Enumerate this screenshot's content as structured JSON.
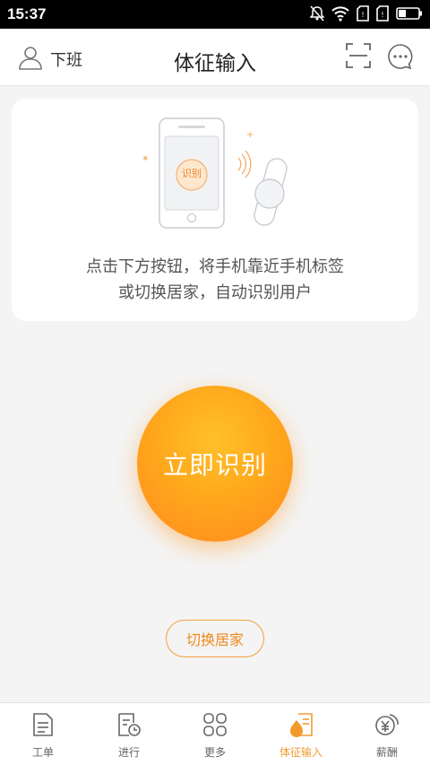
{
  "status_bar": {
    "time": "15:37"
  },
  "header": {
    "user_label": "下班",
    "title": "体征输入"
  },
  "card": {
    "chip_label": "识别",
    "instruction_line1": "点击下方按钮，将手机靠近手机标签",
    "instruction_line2": "或切换居家，自动识别用户"
  },
  "main": {
    "identify_button": "立即识别",
    "switch_home_button": "切换居家"
  },
  "tabs": [
    {
      "label": "工单",
      "icon": "document-icon"
    },
    {
      "label": "进行",
      "icon": "clock-document-icon"
    },
    {
      "label": "更多",
      "icon": "grid-icon"
    },
    {
      "label": "体征输入",
      "icon": "vital-signs-icon",
      "active": true
    },
    {
      "label": "薪酬",
      "icon": "yuan-coin-icon"
    }
  ],
  "colors": {
    "accent": "#f39a2d",
    "button_top": "#ffc02b",
    "button_bottom": "#ff8a1e"
  }
}
